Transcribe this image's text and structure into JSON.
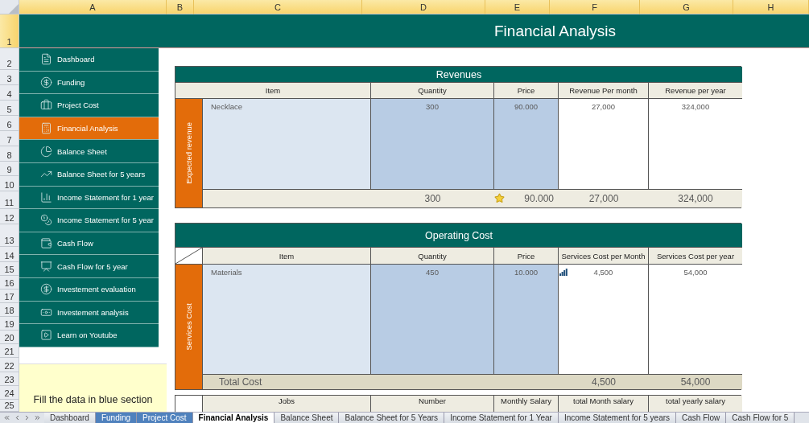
{
  "title": "Financial Analysis",
  "column_headers": [
    {
      "label": "A",
      "selected": true
    },
    {
      "label": "B",
      "selected": true
    },
    {
      "label": "C",
      "selected": true
    },
    {
      "label": "D",
      "selected": true
    },
    {
      "label": "E",
      "selected": true
    },
    {
      "label": "F",
      "selected": true
    },
    {
      "label": "G",
      "selected": true
    },
    {
      "label": "H",
      "selected": true
    }
  ],
  "row_headers": [
    {
      "label": "1",
      "selected": true
    },
    {
      "label": "2",
      "selected": false
    },
    {
      "label": "3",
      "selected": false
    },
    {
      "label": "4",
      "selected": false
    },
    {
      "label": "5",
      "selected": false
    },
    {
      "label": "6",
      "selected": false
    },
    {
      "label": "7",
      "selected": false
    },
    {
      "label": "8",
      "selected": false
    },
    {
      "label": "9",
      "selected": false
    },
    {
      "label": "10",
      "selected": false
    },
    {
      "label": "11",
      "selected": false
    },
    {
      "label": "12",
      "selected": false
    },
    {
      "label": "13",
      "selected": false
    },
    {
      "label": "14",
      "selected": false
    },
    {
      "label": "15",
      "selected": false
    },
    {
      "label": "16",
      "selected": false
    },
    {
      "label": "17",
      "selected": false
    },
    {
      "label": "18",
      "selected": false
    },
    {
      "label": "19",
      "selected": false
    },
    {
      "label": "20",
      "selected": false
    },
    {
      "label": "21",
      "selected": false
    },
    {
      "label": "22",
      "selected": false
    },
    {
      "label": "23",
      "selected": false
    },
    {
      "label": "24",
      "selected": false
    },
    {
      "label": "25",
      "selected": false
    }
  ],
  "sidebar": {
    "items": [
      {
        "label": "Dashboard",
        "selected": false
      },
      {
        "label": "Funding",
        "selected": false
      },
      {
        "label": "Project Cost",
        "selected": false
      },
      {
        "label": "Financial Analysis",
        "selected": true
      },
      {
        "label": "Balance Sheet",
        "selected": false
      },
      {
        "label": "Balance Sheet for 5 years",
        "selected": false
      },
      {
        "label": "Income Statement for 1 year",
        "selected": false
      },
      {
        "label": "Income Statement for 5 year",
        "selected": false
      },
      {
        "label": "Cash Flow",
        "selected": false
      },
      {
        "label": "Cash Flow for 5 year",
        "selected": false
      },
      {
        "label": "Investement evaluation",
        "selected": false
      },
      {
        "label": "Investement analysis",
        "selected": false
      },
      {
        "label": "Learn on Youtube",
        "selected": false
      }
    ],
    "note": "Fill the data in blue section"
  },
  "revenues": {
    "title": "Revenues",
    "side_label": "Expected revenue",
    "columns": [
      "Item",
      "Quantity",
      "Price",
      "Revenue Per month",
      "Revenue per year"
    ],
    "rows": [
      {
        "item": "Necklace",
        "quantity": "300",
        "price": "90.000",
        "per_month": "27,000",
        "per_year": "324,000"
      }
    ],
    "totals": {
      "quantity": "300",
      "price": "90.000",
      "per_month": "27,000",
      "per_year": "324,000"
    }
  },
  "operating_cost": {
    "title": "Operating Cost",
    "side_label": "Services Cost",
    "columns": [
      "Item",
      "Quantity",
      "Price",
      "Services Cost per Month",
      "Services Cost per year"
    ],
    "rows": [
      {
        "item": "Materials",
        "quantity": "450",
        "price": "10.000",
        "per_month": "4,500",
        "per_year": "54,000"
      }
    ],
    "totals": {
      "label": "Total Cost",
      "per_month": "4,500",
      "per_year": "54,000"
    }
  },
  "salaries": {
    "columns": [
      "Jobs",
      "Number",
      "Monthly Salary",
      "total Month salary",
      "total yearly salary"
    ]
  },
  "sheet_tabs": [
    {
      "label": "Dashboard",
      "selected": false
    },
    {
      "label": "Funding",
      "selected": false,
      "color": "#4f81bd"
    },
    {
      "label": "Project Cost",
      "selected": false,
      "color": "#4f81bd"
    },
    {
      "label": "Financial Analysis",
      "selected": true
    },
    {
      "label": "Balance Sheet",
      "selected": false
    },
    {
      "label": "Balance Sheet for 5 Years",
      "selected": false
    },
    {
      "label": "Income Statement for 1 Year",
      "selected": false
    },
    {
      "label": "Income Statement for 5 years",
      "selected": false
    },
    {
      "label": "Cash Flow",
      "selected": false
    },
    {
      "label": "Cash Flow for 5",
      "selected": false
    }
  ]
}
